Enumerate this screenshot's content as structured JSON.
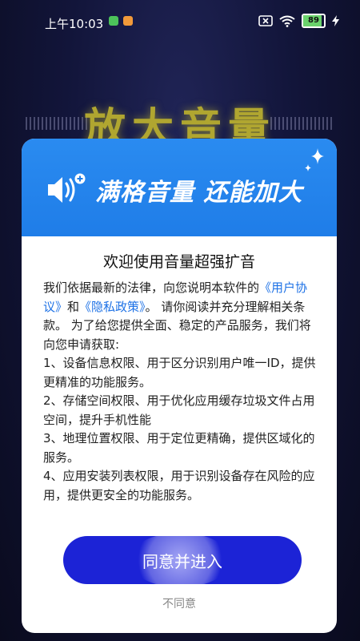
{
  "status_bar": {
    "time": "上午10:03",
    "battery": "89",
    "icons": [
      "green-app-icon",
      "orange-app-icon",
      "sim-x-icon",
      "wifi-icon",
      "battery-icon",
      "charging-icon"
    ]
  },
  "background": {
    "headline": "放大音量"
  },
  "dialog": {
    "banner_title": "满格音量 还能加大",
    "title": "欢迎使用音量超强扩音",
    "intro_1": "我们依据最新的法律，向您说明本软件的",
    "link_user_agreement": "《用户协议》",
    "and": "和",
    "link_privacy_policy": "《隐私政策》",
    "intro_2": "。 请你阅读并充分理解相关条款。 为了给您提供全面、稳定的产品服务，我们将向您申请获取:",
    "items": [
      "1、设备信息权限、用于区分识别用户唯一ID，提供更精准的功能服务。",
      "2、存储空间权限、用于优化应用缓存垃圾文件占用空间，提升手机性能",
      "3、地理位置权限、用于定位更精确，提供区域化的服务。",
      "4、应用安装列表权限，用于识别设备存在风险的应用，提供更安全的功能服务。"
    ],
    "agree_label": "同意并进入",
    "disagree_label": "不同意"
  },
  "colors": {
    "banner": "#1f7de8",
    "button": "#1c23d6",
    "link": "#1e72e6",
    "headline": "#b0a630"
  }
}
